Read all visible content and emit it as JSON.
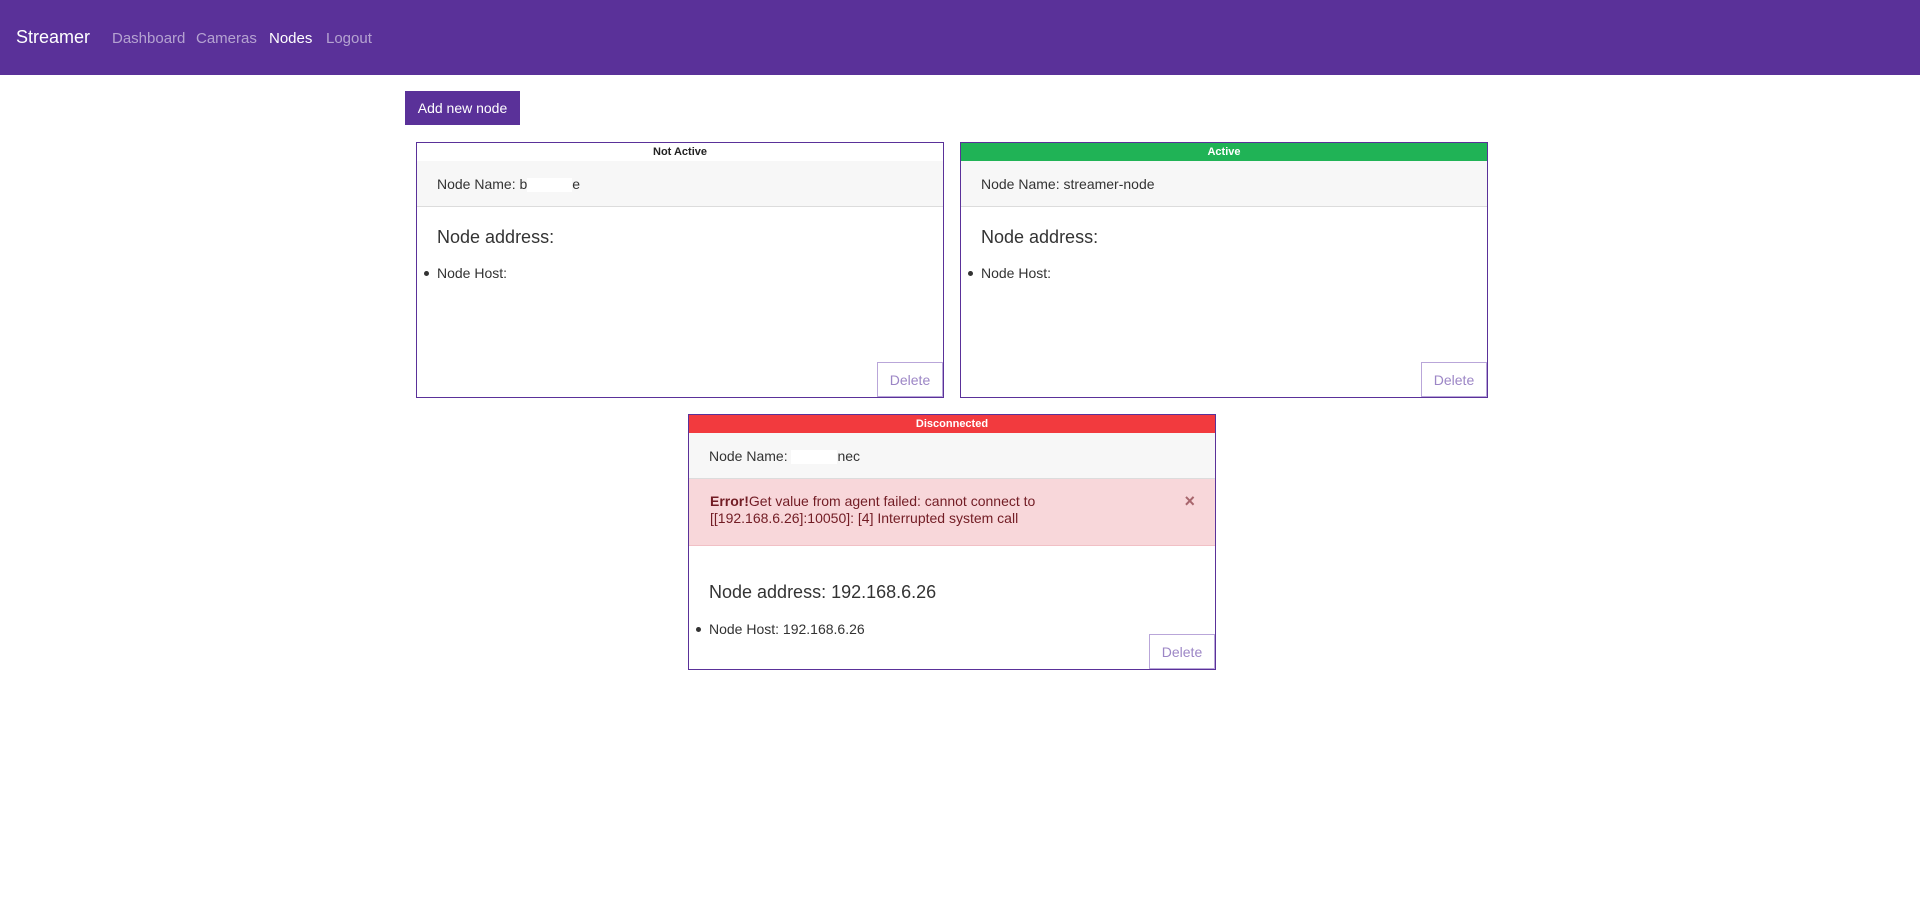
{
  "nav": {
    "brand": "Streamer",
    "links": [
      "Dashboard",
      "Cameras",
      "Nodes",
      "Logout"
    ],
    "active": "Nodes"
  },
  "actions": {
    "add_node": "Add new node"
  },
  "colors": {
    "primary": "#5a3199",
    "active": "#20b356",
    "disconnected": "#f23a3e"
  },
  "nodes": [
    {
      "status": "Not Active",
      "name_label": "Node Name:",
      "name_prefix": "b",
      "name_suffix": "e",
      "address_label": "Node address:",
      "host_label": "Node Host:",
      "delete": "Delete"
    },
    {
      "status": "Active",
      "name_label": "Node Name:",
      "name": "streamer-node",
      "address_label": "Node address:",
      "host_label": "Node Host:",
      "delete": "Delete"
    },
    {
      "status": "Disconnected",
      "name_label": "Node Name:",
      "name_suffix": "nec",
      "error_title": "Error!",
      "error_message": "Get value from agent failed: cannot connect to [[192.168.6.26]:10050]: [4] Interrupted system call",
      "close": "×",
      "address_label": "Node address: 192.168.6.26",
      "host_label": "Node Host: 192.168.6.26",
      "delete": "Delete"
    }
  ]
}
